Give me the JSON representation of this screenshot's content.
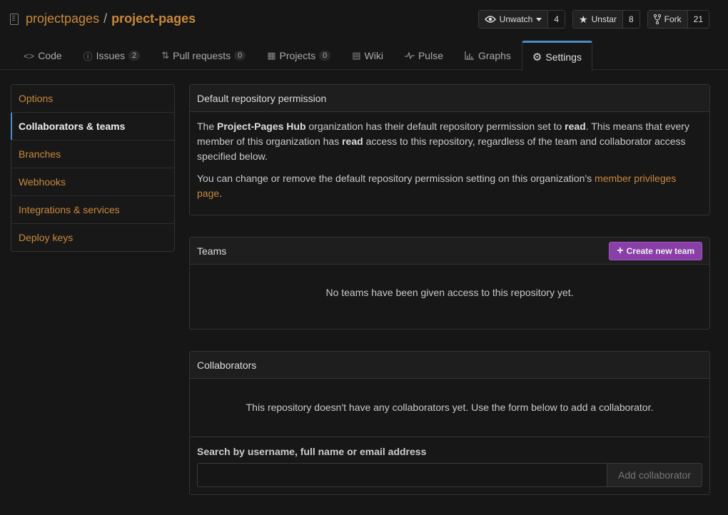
{
  "repo": {
    "owner": "projectpages",
    "separator": "/",
    "name": "project-pages"
  },
  "actions": {
    "watch": {
      "label": "Unwatch",
      "count": "4",
      "icon": "eye-icon"
    },
    "star": {
      "label": "Unstar",
      "count": "8",
      "icon": "star-icon"
    },
    "fork": {
      "label": "Fork",
      "count": "21",
      "icon": "fork-icon"
    }
  },
  "tabs": [
    {
      "label": "Code",
      "icon": "code-icon"
    },
    {
      "label": "Issues",
      "count": "2",
      "icon": "issue-icon"
    },
    {
      "label": "Pull requests",
      "count": "0",
      "icon": "pull-request-icon"
    },
    {
      "label": "Projects",
      "count": "0",
      "icon": "project-icon"
    },
    {
      "label": "Wiki",
      "icon": "book-icon"
    },
    {
      "label": "Pulse",
      "icon": "pulse-icon"
    },
    {
      "label": "Graphs",
      "icon": "graph-icon"
    },
    {
      "label": "Settings",
      "icon": "gear-icon",
      "selected": true
    }
  ],
  "sidebar": {
    "items": [
      {
        "label": "Options"
      },
      {
        "label": "Collaborators & teams",
        "selected": true
      },
      {
        "label": "Branches"
      },
      {
        "label": "Webhooks"
      },
      {
        "label": "Integrations & services"
      },
      {
        "label": "Deploy keys"
      }
    ]
  },
  "default_permission": {
    "title": "Default repository permission",
    "p1_a": "The ",
    "org": "Project-Pages Hub",
    "p1_b": " organization has their default repository permission set to ",
    "perm1": "read",
    "p1_c": ". This means that every member of this organization has ",
    "perm2": "read",
    "p1_d": " access to this repository, regardless of the team and collaborator access specified below.",
    "p2": "You can change or remove the default repository permission setting on this organization's ",
    "link": "member privileges page",
    "p2_end": "."
  },
  "teams": {
    "title": "Teams",
    "create_label": "Create new team",
    "empty": "No teams have been given access to this repository yet."
  },
  "collaborators": {
    "title": "Collaborators",
    "empty": "This repository doesn't have any collaborators yet. Use the form below to add a collaborator.",
    "search_label": "Search by username, full name or email address",
    "search_value": "",
    "add_label": "Add collaborator"
  },
  "colors": {
    "accent": "#c9883a",
    "selected_bar": "#4d8bc9",
    "create_button": "#8a3fa8",
    "background": "#161616"
  }
}
